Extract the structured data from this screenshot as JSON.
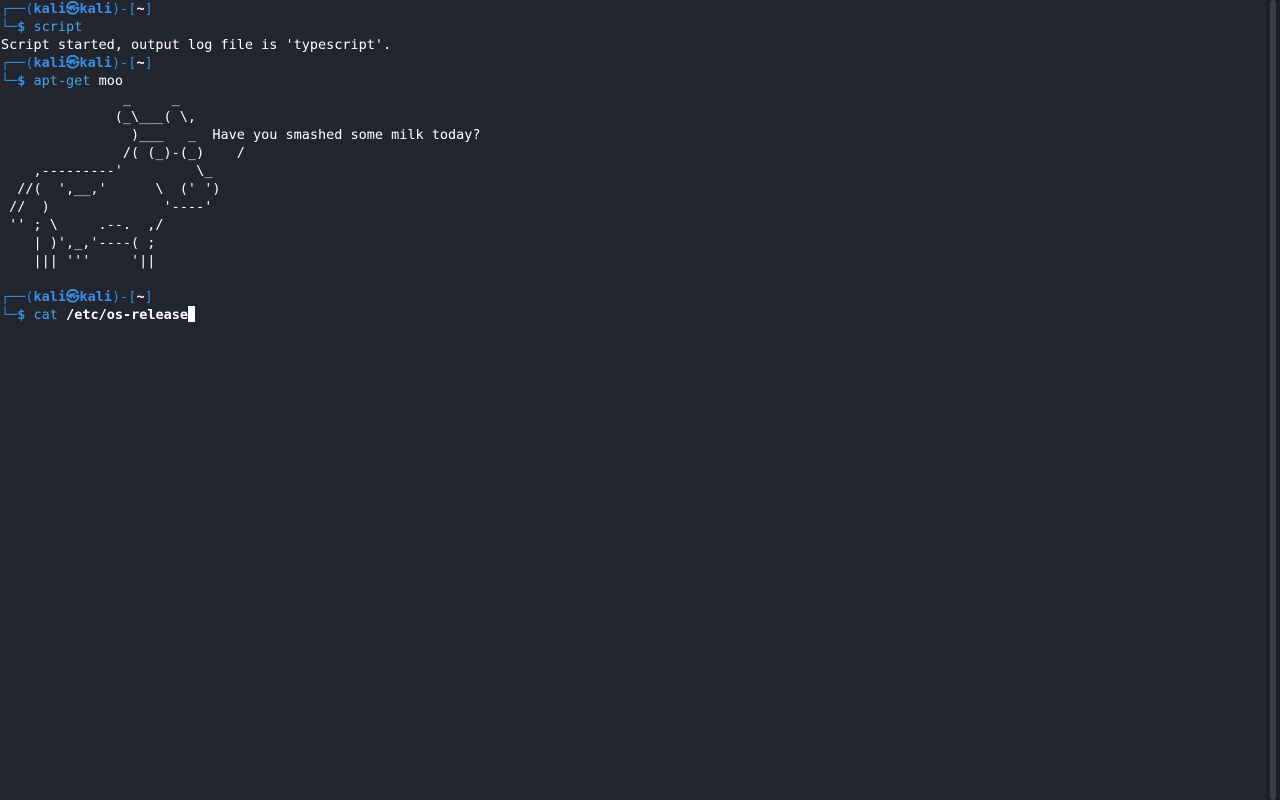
{
  "prompt": {
    "top_prefix": "┌──(",
    "user": "kali㉿kali",
    "mid": ")-[",
    "dir": "~",
    "end": "]",
    "bottom_prefix": "└─",
    "dollar": "$ "
  },
  "blocks": [
    {
      "command": "script",
      "arg": ""
    },
    {
      "command": "apt-get",
      "arg": "moo"
    },
    {
      "command": "cat",
      "arg": "/etc/os-release"
    }
  ],
  "outputs": {
    "script_output": "Script started, output log file is 'typescript'.",
    "moo_art": "               _     _\n              (_\\___( \\,\n                )___   _  Have you smashed some milk today?\n               /( (_)-(_)    /\n    ,---------'         \\_\n  //(  ',__,'      \\  (' ')\n //  )              '----'\n '' ; \\     .--.  ,/\n    | )',_,'----( ;\n    ||| '''     '||"
  },
  "colors": {
    "background": "#23252e",
    "prompt_blue": "#2f8cd8",
    "command_blue": "#4aa3e8",
    "text": "#ffffff"
  }
}
